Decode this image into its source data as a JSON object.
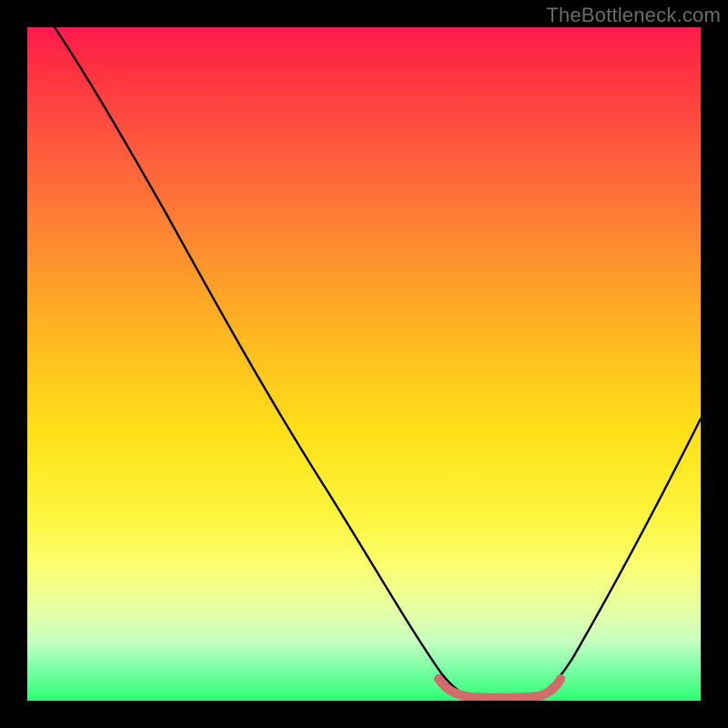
{
  "watermark": "TheBottleneck.com",
  "chart_data": {
    "type": "line",
    "title": "",
    "xlabel": "",
    "ylabel": "",
    "xlim": [
      0,
      100
    ],
    "ylim": [
      0,
      100
    ],
    "series": [
      {
        "name": "bottleneck-curve",
        "x": [
          4,
          10,
          20,
          30,
          40,
          50,
          58,
          62,
          66,
          70,
          74,
          80,
          86,
          92,
          100
        ],
        "values": [
          100,
          90,
          74,
          58,
          44,
          30,
          16,
          8,
          3,
          1,
          1,
          3,
          10,
          22,
          42
        ]
      },
      {
        "name": "optimal-band",
        "x": [
          62,
          66,
          70,
          74,
          78
        ],
        "values": [
          2.5,
          1.2,
          1.0,
          1.2,
          2.5
        ]
      }
    ],
    "annotations": [],
    "colors": {
      "curve": "#000000",
      "optimal_band": "#d46a6a",
      "gradient_top": "#ff1a4d",
      "gradient_bottom": "#2cff74"
    }
  }
}
